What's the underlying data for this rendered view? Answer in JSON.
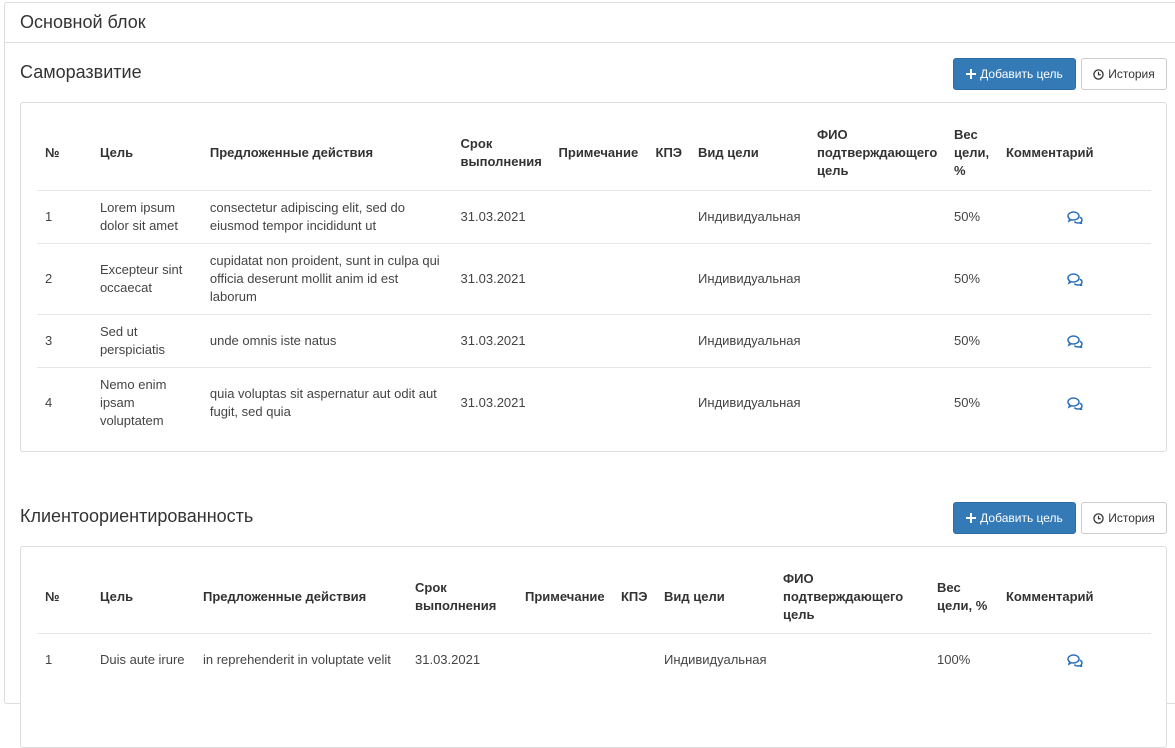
{
  "panel": {
    "title": "Основной блок"
  },
  "colors": {
    "primary": "#337ab7",
    "icon": "#2a6ebb"
  },
  "sections": [
    {
      "title": "Саморазвитие",
      "add_label": "Добавить цель",
      "history_label": "История",
      "columns": [
        "№",
        "Цель",
        "Предложенные действия",
        "Срок выполнения",
        "Примечание",
        "КПЭ",
        "Вид цели",
        "ФИО подтверждающего цель",
        "Вес цели, %",
        "Комментарий"
      ],
      "rows": [
        {
          "num": "1",
          "goal": "Lorem ipsum dolor sit amet",
          "actions": " consectetur adipiscing elit, sed do eiusmod tempor incididunt ut",
          "deadline": "31.03.2021",
          "note": "",
          "kpi": "",
          "type": "Индивидуальная",
          "confirmer": "",
          "weight": "50%",
          "comment_icon": "comments-icon"
        },
        {
          "num": "2",
          "goal": "Excepteur sint occaecat",
          "actions": "cupidatat non proident, sunt in culpa qui officia deserunt mollit anim id est laborum",
          "deadline": "31.03.2021",
          "note": "",
          "kpi": "",
          "type": "Индивидуальная",
          "confirmer": "",
          "weight": "50%",
          "comment_icon": "comments-icon"
        },
        {
          "num": "3",
          "goal": "Sed ut perspiciatis",
          "actions": "unde omnis iste natus",
          "deadline": "31.03.2021",
          "note": "",
          "kpi": "",
          "type": "Индивидуальная",
          "confirmer": "",
          "weight": "50%",
          "comment_icon": "comments-icon"
        },
        {
          "num": "4",
          "goal": "Nemo enim ipsam voluptatem",
          "actions": "quia voluptas sit aspernatur aut odit aut fugit, sed quia",
          "deadline": "31.03.2021",
          "note": "",
          "kpi": "",
          "type": "Индивидуальная",
          "confirmer": "",
          "weight": "50%",
          "comment_icon": "comments-icon"
        }
      ]
    },
    {
      "title": "Клиентоориентированность",
      "add_label": "Добавить цель",
      "history_label": "История",
      "columns": [
        "№",
        "Цель",
        "Предложенные действия",
        "Срок выполнения",
        "Примечание",
        "КПЭ",
        "Вид цели",
        "ФИО подтверждающего цель",
        "Вес цели, %",
        "Комментарий"
      ],
      "rows": [
        {
          "num": "1",
          "goal": "Duis aute irure",
          "actions": "in reprehenderit in voluptate velit",
          "deadline": "31.03.2021",
          "note": "",
          "kpi": "",
          "type": "Индивидуальная",
          "confirmer": "",
          "weight": "100%",
          "comment_icon": "comments-icon"
        }
      ]
    }
  ]
}
